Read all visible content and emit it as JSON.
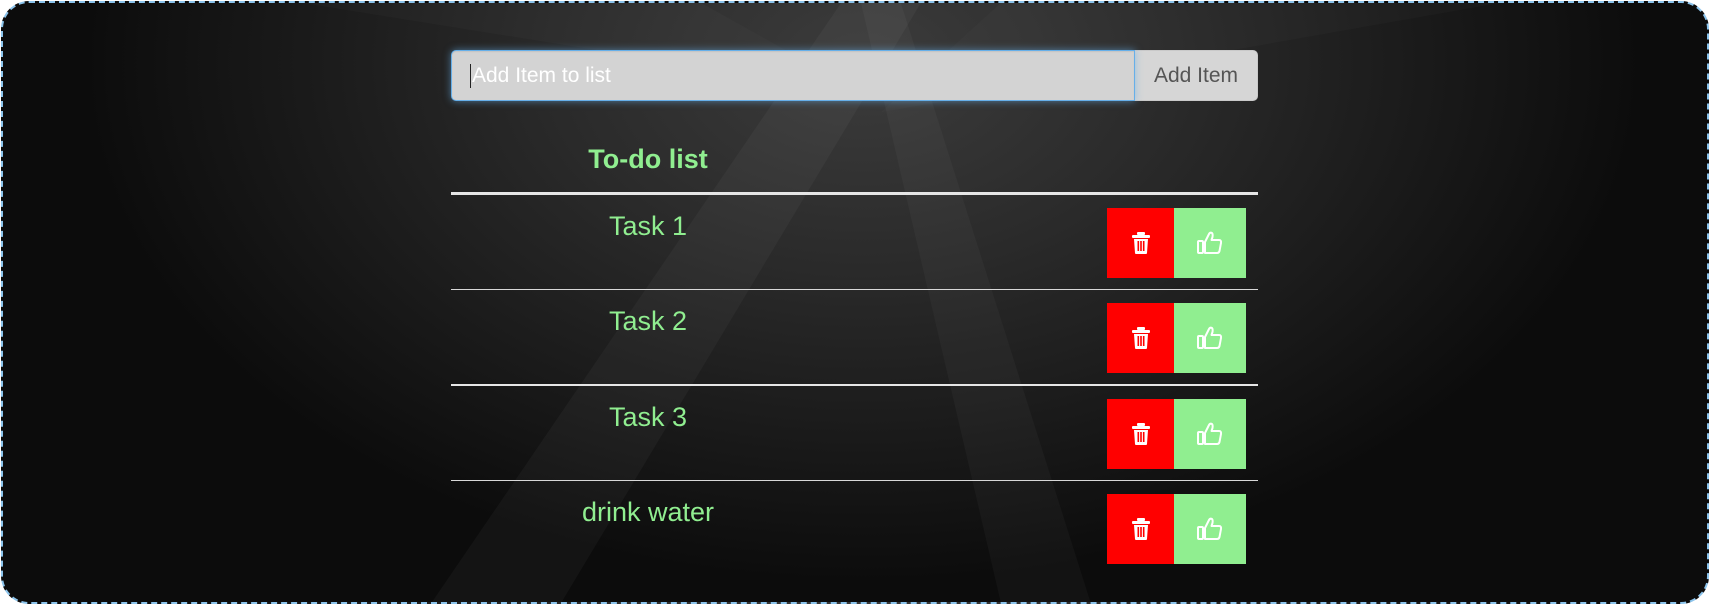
{
  "input": {
    "placeholder": "Add Item to list",
    "value": ""
  },
  "add_button_label": "Add Item",
  "list": {
    "title": "To-do list",
    "items": [
      {
        "label": "Task 1",
        "delete_icon": "trash-icon",
        "done_icon": "thumbs-up-icon"
      },
      {
        "label": "Task 2",
        "delete_icon": "trash-icon",
        "done_icon": "thumbs-up-icon"
      },
      {
        "label": "Task 3",
        "delete_icon": "trash-icon",
        "done_icon": "thumbs-up-icon"
      },
      {
        "label": "drink water",
        "delete_icon": "trash-icon",
        "done_icon": "thumbs-up-icon"
      }
    ]
  },
  "colors": {
    "accent_text": "#90ee90",
    "delete": "#ff0000",
    "done": "#90ee90",
    "input_focus_border": "#66afe9"
  }
}
